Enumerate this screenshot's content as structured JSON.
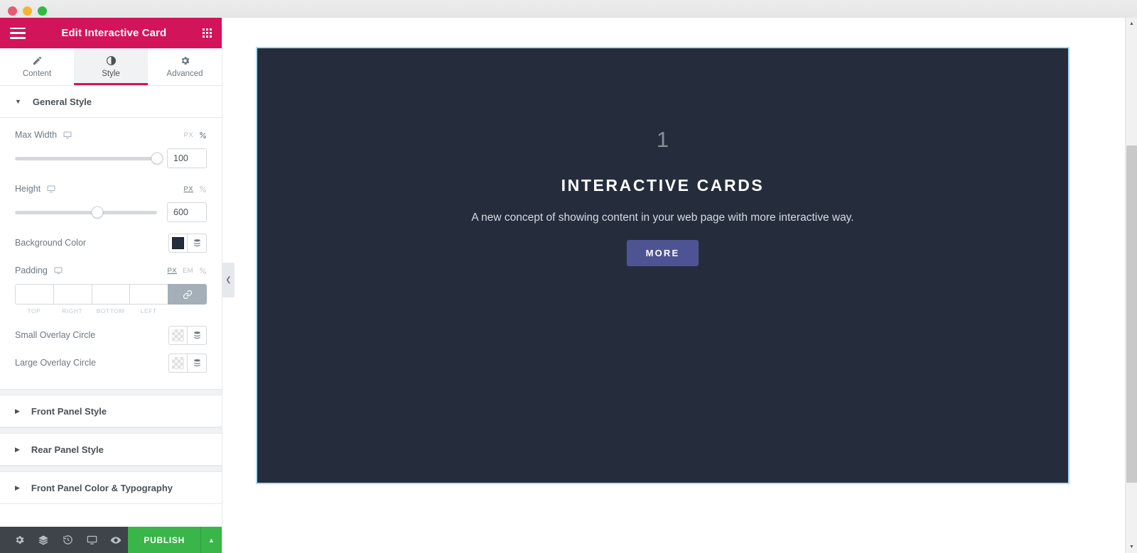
{
  "window": {
    "traffic_lights": [
      "close",
      "minimize",
      "maximize"
    ]
  },
  "panel": {
    "header": {
      "title": "Edit Interactive Card",
      "menu_icon": "hamburger-icon",
      "apps_icon": "grid-apps-icon",
      "background_color": "#d2145a"
    },
    "tabs": [
      {
        "label": "Content",
        "icon": "pencil-icon",
        "active": false
      },
      {
        "label": "Style",
        "icon": "contrast-half-circle-icon",
        "active": true
      },
      {
        "label": "Advanced",
        "icon": "gear-icon",
        "active": false
      }
    ],
    "sections": [
      {
        "title": "General Style",
        "expanded": true
      },
      {
        "title": "Front Panel Style",
        "expanded": false
      },
      {
        "title": "Rear Panel Style",
        "expanded": false
      },
      {
        "title": "Front Panel Color & Typography",
        "expanded": false
      }
    ],
    "controls": {
      "max_width": {
        "label": "Max Width",
        "responsive_icon": "desktop-icon",
        "units": [
          {
            "label": "PX",
            "active": false
          },
          {
            "label": "%",
            "active": true
          }
        ],
        "value": "100",
        "slider_percent": 100
      },
      "height": {
        "label": "Height",
        "responsive_icon": "desktop-icon",
        "units": [
          {
            "label": "PX",
            "active": true
          },
          {
            "label": "%",
            "active": false
          }
        ],
        "value": "600",
        "slider_percent": 58
      },
      "background_color": {
        "label": "Background Color",
        "swatch_color": "#252d3d",
        "globals_icon": "globals-stack-icon"
      },
      "padding": {
        "label": "Padding",
        "responsive_icon": "desktop-icon",
        "units": [
          {
            "label": "PX",
            "active": true
          },
          {
            "label": "EM",
            "active": false
          },
          {
            "label": "%",
            "active": false
          }
        ],
        "fields": [
          {
            "sub_label": "TOP",
            "value": ""
          },
          {
            "sub_label": "RIGHT",
            "value": ""
          },
          {
            "sub_label": "BOTTOM",
            "value": ""
          },
          {
            "sub_label": "LEFT",
            "value": ""
          }
        ],
        "link_icon": "link-chain-icon",
        "linked": true
      },
      "small_overlay_circle": {
        "label": "Small Overlay Circle",
        "swatch_color": "transparent",
        "globals_icon": "globals-stack-icon"
      },
      "large_overlay_circle": {
        "label": "Large Overlay Circle",
        "swatch_color": "transparent",
        "globals_icon": "globals-stack-icon"
      }
    },
    "collapse_handle": {
      "icon": "chevron-left-icon"
    },
    "footer": {
      "icons": [
        {
          "name": "settings-gear-icon"
        },
        {
          "name": "layers-navigator-icon"
        },
        {
          "name": "history-clock-icon"
        },
        {
          "name": "responsive-monitor-icon"
        },
        {
          "name": "preview-eye-icon"
        }
      ],
      "publish_label": "PUBLISH",
      "publish_caret_icon": "caret-up-icon",
      "publish_color": "#39b54a"
    }
  },
  "canvas": {
    "card": {
      "number": "1",
      "title": "INTERACTIVE CARDS",
      "description": "A new concept of showing content in your web page with more interactive way.",
      "button_label": "MORE",
      "background_color": "#252d3d",
      "button_color": "#4e5493",
      "selection_outline_color": "#a8dcf0"
    },
    "scrollbar": {
      "up_icon": "scroll-up-arrow",
      "down_icon": "scroll-down-arrow"
    }
  }
}
